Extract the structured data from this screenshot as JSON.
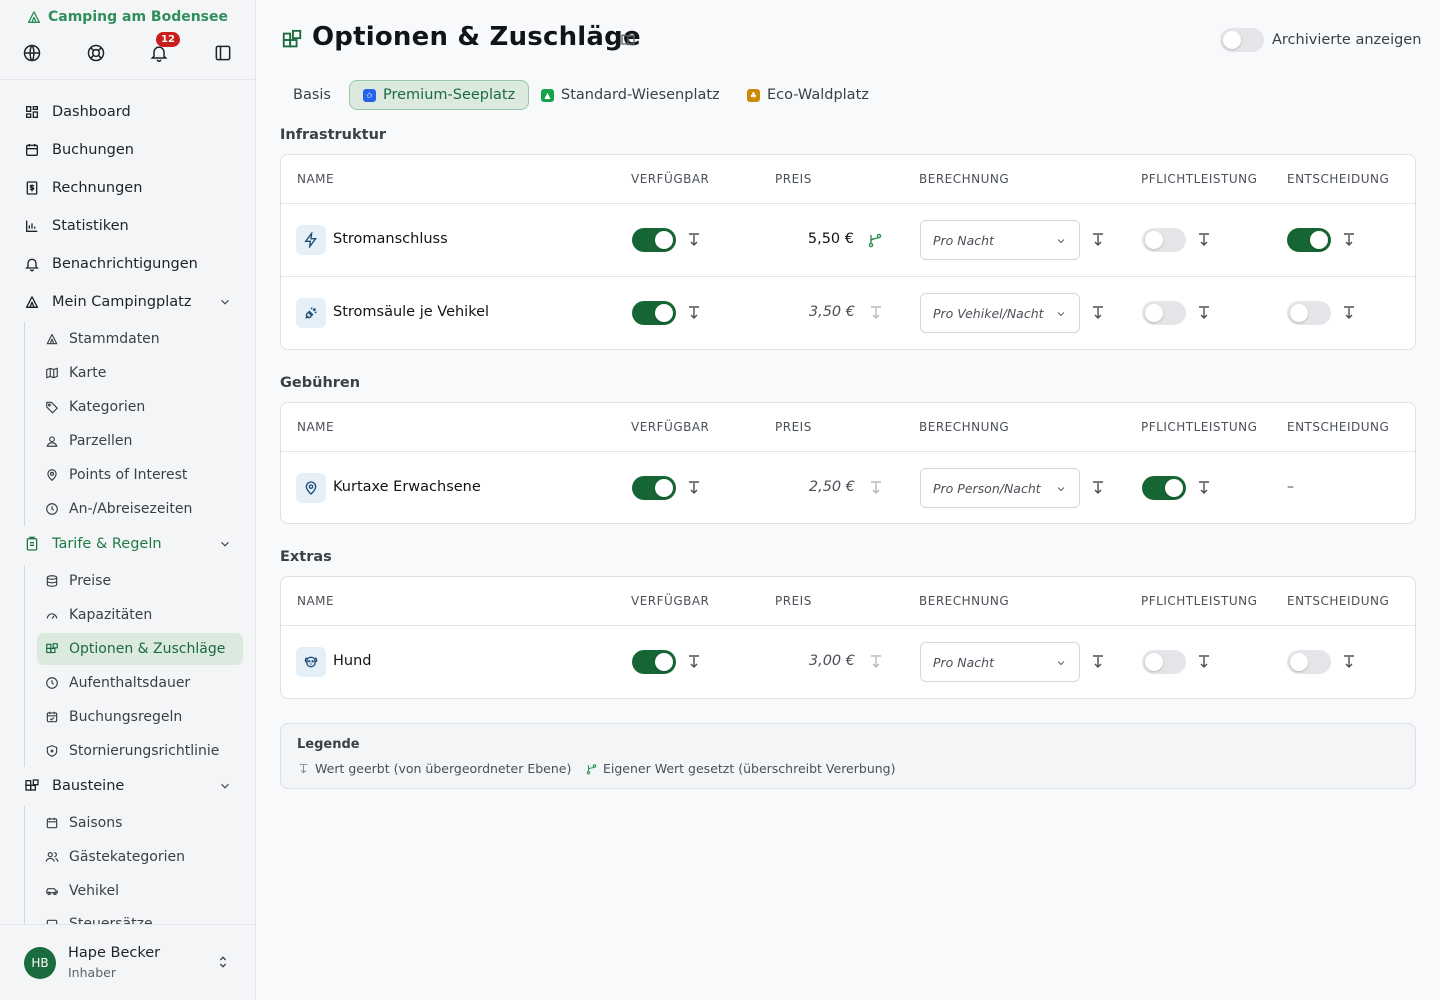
{
  "sidebar": {
    "brand": "Camping am Bodensee",
    "notification_count": "12",
    "nav": [
      {
        "label": "Dashboard"
      },
      {
        "label": "Buchungen"
      },
      {
        "label": "Rechnungen"
      },
      {
        "label": "Statistiken"
      },
      {
        "label": "Benachrichtigungen"
      },
      {
        "label": "Mein Campingplatz"
      },
      {
        "label": "Tarife & Regeln"
      },
      {
        "label": "Bausteine"
      }
    ],
    "campingplatz_items": [
      {
        "label": "Stammdaten"
      },
      {
        "label": "Karte"
      },
      {
        "label": "Kategorien"
      },
      {
        "label": "Parzellen"
      },
      {
        "label": "Points of Interest"
      },
      {
        "label": "An-/Abreisezeiten"
      }
    ],
    "tarife_items": [
      {
        "label": "Preise"
      },
      {
        "label": "Kapazitäten"
      },
      {
        "label": "Optionen & Zuschläge"
      },
      {
        "label": "Aufenthaltsdauer"
      },
      {
        "label": "Buchungsregeln"
      },
      {
        "label": "Stornierungsrichtlinie"
      }
    ],
    "bausteine_items": [
      {
        "label": "Saisons"
      },
      {
        "label": "Gästekategorien"
      },
      {
        "label": "Vehikel"
      },
      {
        "label": "Steuersätze"
      }
    ],
    "user": {
      "initials": "HB",
      "name": "Hape Becker",
      "role": "Inhaber"
    }
  },
  "page": {
    "title": "Optionen & Zuschläge",
    "archive_label": "Archivierte anzeigen",
    "archive_on": false
  },
  "tabs": [
    {
      "label": "Basis",
      "active": false
    },
    {
      "label": "Premium-Seeplatz",
      "active": true,
      "color": "#2563eb"
    },
    {
      "label": "Standard-Wiesenplatz",
      "active": false,
      "color": "#16a34a"
    },
    {
      "label": "Eco-Waldplatz",
      "active": false,
      "color": "#ca8a04"
    }
  ],
  "columns": {
    "name": "NAME",
    "available": "VERFÜGBAR",
    "price": "PREIS",
    "calc": "BERECHNUNG",
    "mandatory": "PFLICHTLEISTUNG",
    "decision": "ENTSCHEIDUNG"
  },
  "sections": [
    {
      "title": "Infrastruktur",
      "rows": [
        {
          "name": "Stromanschluss",
          "icon": "bolt-icon",
          "available": true,
          "price": "5,50 €",
          "price_own": true,
          "calc": "Pro Nacht",
          "mandatory": false,
          "decision": true
        },
        {
          "name": "Stromsäule je Vehikel",
          "icon": "plug-icon",
          "available": true,
          "price": "3,50 €",
          "price_own": false,
          "calc": "Pro Vehikel/Nacht",
          "mandatory": false,
          "decision": false
        }
      ]
    },
    {
      "title": "Gebühren",
      "rows": [
        {
          "name": "Kurtaxe Erwachsene",
          "icon": "map-pin-icon",
          "available": true,
          "price": "2,50 €",
          "price_own": false,
          "calc": "Pro Person/Nacht",
          "mandatory": true,
          "decision_text": "–"
        }
      ]
    },
    {
      "title": "Extras",
      "rows": [
        {
          "name": "Hund",
          "icon": "dog-icon",
          "available": true,
          "price": "3,00 €",
          "price_own": false,
          "calc": "Pro Nacht",
          "mandatory": false,
          "decision": false
        }
      ]
    }
  ],
  "legend": {
    "title": "Legende",
    "inherited": "Wert geerbt (von übergeordneter Ebene)",
    "own": "Eigener Wert gesetzt (überschreibt Vererbung)"
  },
  "colors": {
    "primary": "#166534",
    "active_bg": "#dbe9df",
    "brand": "#2f8f5b",
    "badge": "#c81e1e"
  }
}
